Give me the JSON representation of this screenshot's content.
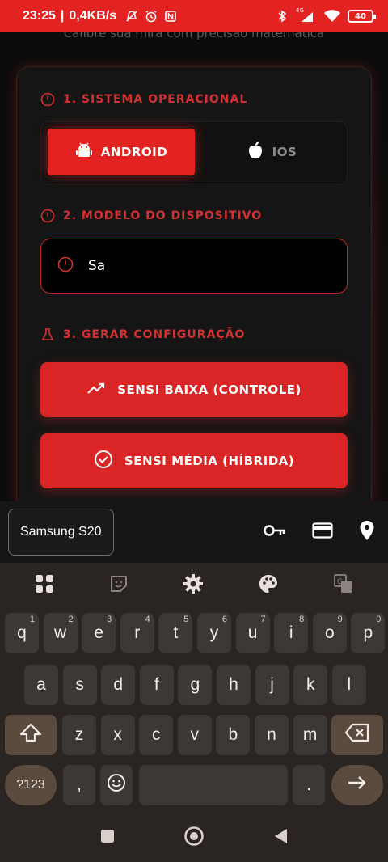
{
  "status_bar": {
    "time": "23:25",
    "net_speed": "0,4KB/s",
    "signal_label": "4G",
    "battery": "40",
    "bg_color": "#e32222"
  },
  "app": {
    "subtitle": "Calibre sua mira com precisão matemática",
    "accent_color": "#d92525",
    "section1": {
      "title": "1. SISTEMA OPERACIONAL",
      "icon": "circle-dot-icon"
    },
    "os_options": [
      {
        "label": "ANDROID",
        "icon": "android-icon",
        "selected": true
      },
      {
        "label": "IOS",
        "icon": "apple-icon",
        "selected": false
      }
    ],
    "section2": {
      "title": "2. MODELO DO DISPOSITIVO",
      "icon": "circle-dot-icon"
    },
    "device_input": {
      "value": "Sa",
      "icon": "device-icon"
    },
    "section3": {
      "title": "3. GERAR CONFIGURAÇÃO",
      "icon": "flask-icon"
    },
    "buttons": [
      {
        "label": "SENSI BAIXA (CONTROLE)",
        "icon": "trending-up-icon"
      },
      {
        "label": "SENSI MÉDIA (HÍBRIDA)",
        "icon": "check-circle-icon"
      }
    ]
  },
  "autofill": {
    "suggestion": "Samsung S20",
    "icons": [
      "key-icon",
      "card-icon",
      "location-icon"
    ]
  },
  "keyboard": {
    "toolbar_icons": [
      "apps-grid-icon",
      "sticker-icon",
      "settings-icon",
      "palette-icon",
      "translate-icon"
    ],
    "row1": [
      {
        "k": "q",
        "n": "1"
      },
      {
        "k": "w",
        "n": "2"
      },
      {
        "k": "e",
        "n": "3"
      },
      {
        "k": "r",
        "n": "4"
      },
      {
        "k": "t",
        "n": "5"
      },
      {
        "k": "y",
        "n": "6"
      },
      {
        "k": "u",
        "n": "7"
      },
      {
        "k": "i",
        "n": "8"
      },
      {
        "k": "o",
        "n": "9"
      },
      {
        "k": "p",
        "n": "0"
      }
    ],
    "row2": [
      "a",
      "s",
      "d",
      "f",
      "g",
      "h",
      "j",
      "k",
      "l"
    ],
    "row3": [
      "z",
      "x",
      "c",
      "v",
      "b",
      "n",
      "m"
    ],
    "symbols_key": "?123",
    "comma_key": ",",
    "period_key": "."
  }
}
